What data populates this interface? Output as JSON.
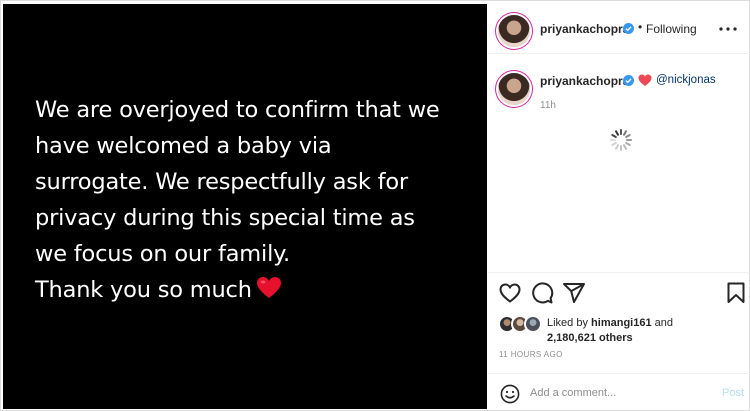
{
  "post_media": {
    "lines": [
      "We are overjoyed to confirm that we",
      "have welcomed a baby via",
      "surrogate. We respectfully ask for",
      "privacy during this special time as",
      "we focus on our family.",
      "Thank you so much"
    ],
    "emoji_icon": "red-heart-emoji"
  },
  "header": {
    "username": "priyankachopra",
    "separator": "•",
    "follow_status": "Following",
    "verified_icon": "verified-badge-icon",
    "more_icon": "more-options-icon"
  },
  "caption": {
    "username": "priyankachopra",
    "mention": "@nickjonas",
    "time_ago": "11h",
    "heart_color": "#ed4956"
  },
  "actions": {
    "like_icon": "heart-outline-icon",
    "comment_icon": "comment-icon",
    "share_icon": "share-icon",
    "save_icon": "bookmark-icon"
  },
  "likes": {
    "prefix": "Liked by",
    "liker": "himangi161",
    "and": "and",
    "others": "2,180,621 others"
  },
  "timestamp": "11 HOURS AGO",
  "comment": {
    "placeholder": "Add a comment...",
    "post_label": "Post",
    "emoji_icon": "smiley-icon"
  },
  "colors": {
    "verified_blue": "#3897f0",
    "post_button_disabled": "#b2dffc",
    "mention": "#00376b"
  }
}
